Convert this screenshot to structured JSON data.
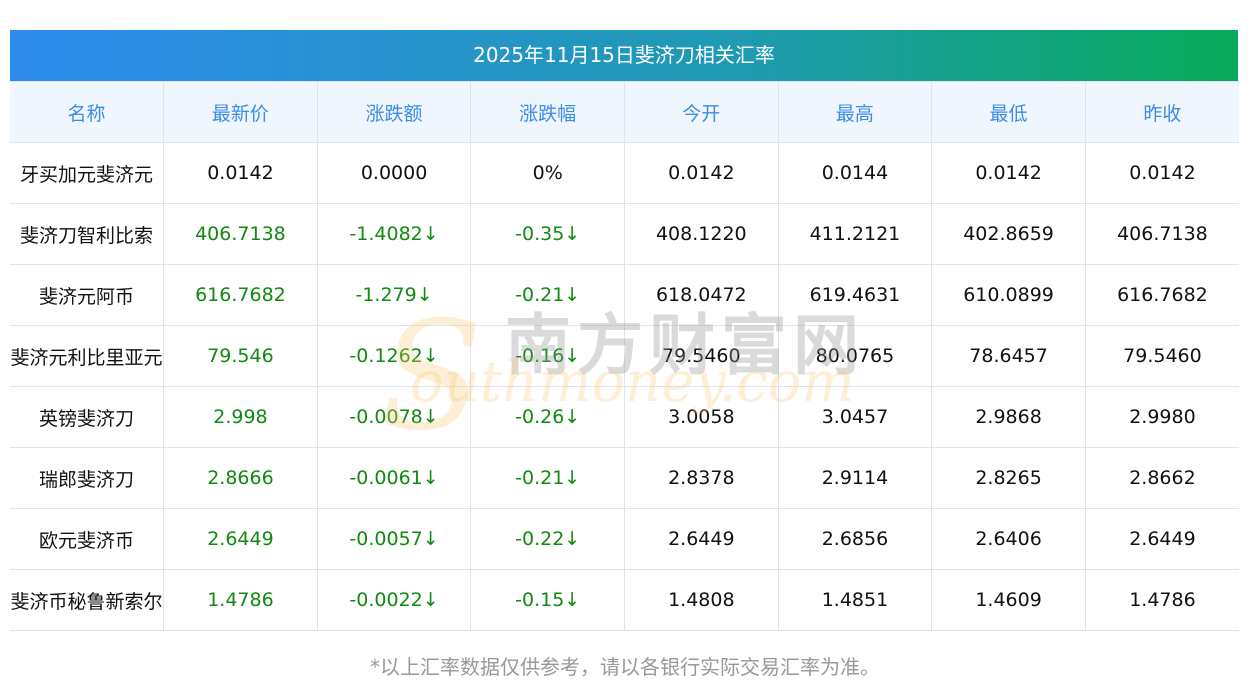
{
  "title": "2025年11月15日斐济刀相关汇率",
  "headers": [
    "名称",
    "最新价",
    "涨跌额",
    "涨跌幅",
    "今开",
    "最高",
    "最低",
    "昨收"
  ],
  "rows": [
    [
      "牙买加元斐济元",
      "0.0142",
      "0.0000",
      "0%",
      "0.0142",
      "0.0144",
      "0.0142",
      "0.0142"
    ],
    [
      "斐济刀智利比索",
      "406.7138",
      "-1.4082↓",
      "-0.35↓",
      "408.1220",
      "411.2121",
      "402.8659",
      "406.7138"
    ],
    [
      "斐济元阿币",
      "616.7682",
      "-1.279↓",
      "-0.21↓",
      "618.0472",
      "619.4631",
      "610.0899",
      "616.7682"
    ],
    [
      "斐济元利比里亚元",
      "79.546",
      "-0.1262↓",
      "-0.16↓",
      "79.5460",
      "80.0765",
      "78.6457",
      "79.5460"
    ],
    [
      "英镑斐济刀",
      "2.998",
      "-0.0078↓",
      "-0.26↓",
      "3.0058",
      "3.0457",
      "2.9868",
      "2.9980"
    ],
    [
      "瑞郎斐济刀",
      "2.8666",
      "-0.0061↓",
      "-0.21↓",
      "2.8378",
      "2.9114",
      "2.8265",
      "2.8662"
    ],
    [
      "欧元斐济币",
      "2.6449",
      "-0.0057↓",
      "-0.22↓",
      "2.6449",
      "2.6856",
      "2.6406",
      "2.6449"
    ],
    [
      "斐济币秘鲁新索尔",
      "1.4786",
      "-0.0022↓",
      "-0.15↓",
      "1.4808",
      "1.4851",
      "1.4609",
      "1.4786"
    ]
  ],
  "watermark": {
    "cn": "南方财富网",
    "en": "outhmoney.com",
    "s": "S"
  },
  "footer": "*以上汇率数据仅供参考，请以各银行实际交易汇率为准。",
  "colors": {
    "down": "#118a11",
    "header_text": "#3b8de6"
  }
}
